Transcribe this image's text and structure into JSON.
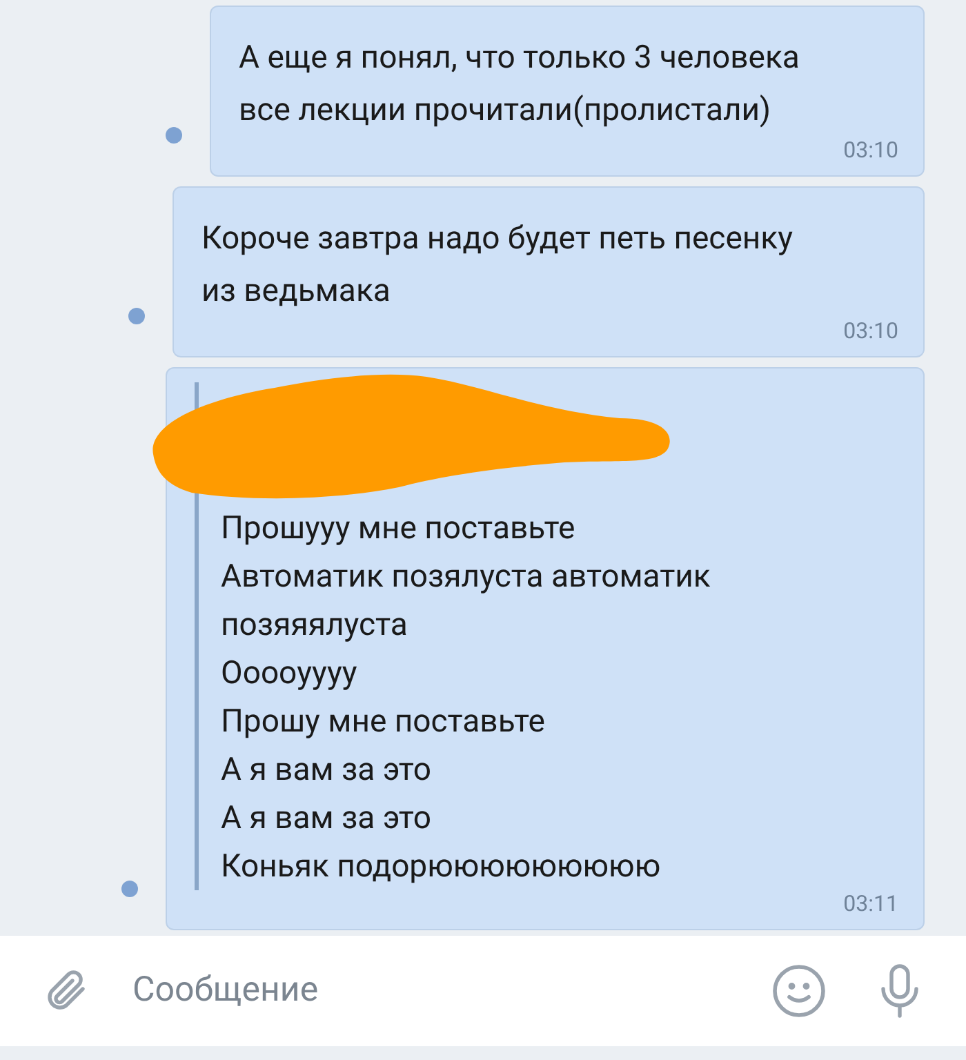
{
  "messages": [
    {
      "kind": "text",
      "text": "А еще я понял, что только 3 человека все лекции прочитали(пролистали)",
      "time": "03:10",
      "unread": true
    },
    {
      "kind": "text",
      "text": "Короче завтра надо будет петь песенку из ведьмака",
      "time": "03:10",
      "unread": true
    },
    {
      "kind": "forward",
      "lines": [
        "Прошууу мне поставьте",
        "Автоматик позялуста автоматик позяяялуста",
        "Оооoуууу",
        "Прошу мне поставьте",
        "А я вам за это",
        "А я вам за это",
        "Коньяк подорююююююююю"
      ],
      "time": "03:11",
      "unread": true
    }
  ],
  "composer": {
    "placeholder": "Сообщение"
  }
}
